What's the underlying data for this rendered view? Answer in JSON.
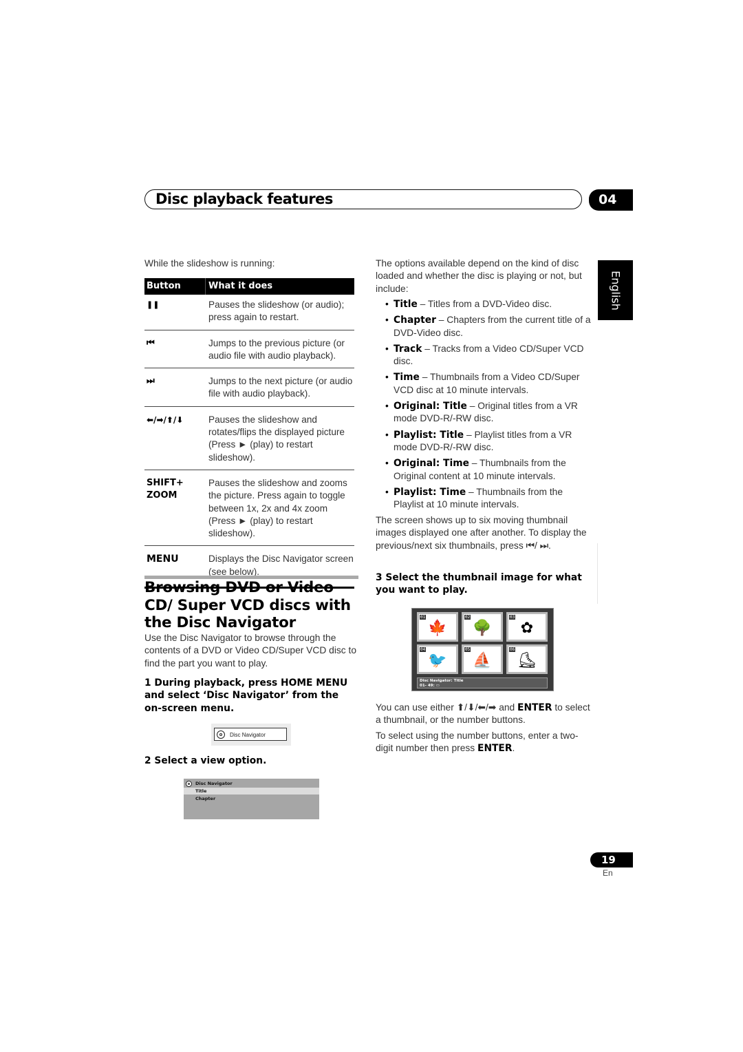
{
  "header": {
    "title": "Disc playback features",
    "chapter": "04"
  },
  "language_tab": "English",
  "left_column": {
    "intro": "While the slideshow is running:",
    "table": {
      "headers": [
        "Button",
        "What it does"
      ],
      "rows": [
        {
          "button": "❚❚",
          "button_icon": "pause-icon",
          "desc": "Pauses the slideshow (or audio); press again to restart."
        },
        {
          "button": "⏮",
          "button_icon": "previous-icon",
          "desc": "Jumps to the previous picture (or audio file with audio playback)."
        },
        {
          "button": "⏭",
          "button_icon": "next-icon",
          "desc": "Jumps to the next picture (or audio file with audio playback)."
        },
        {
          "button": "⬅/➡/⬆/⬇",
          "button_icon": "arrow-keys-icon",
          "desc": "Pauses the slideshow and rotates/flips the displayed picture (Press ► (play) to restart slideshow)."
        },
        {
          "button": "SHIFT+ ZOOM",
          "button_icon": "",
          "desc": "Pauses the slideshow and zooms the picture. Press again to toggle between 1x, 2x and 4x zoom (Press ► (play) to restart slideshow)."
        },
        {
          "button": "MENU",
          "button_icon": "",
          "desc": "Displays the Disc Navigator screen (see below)."
        }
      ]
    },
    "section_title": "Browsing DVD or Video CD/ Super VCD discs with the Disc Navigator",
    "section_intro": "Use the Disc Navigator to browse through the contents of a DVD or Video CD/Super VCD disc to find the part you want to play.",
    "step1": "1   During playback, press HOME MENU and select ‘Disc Navigator’ from the on-screen menu.",
    "disc_nav_item": "Disc Navigator",
    "step2": "2   Select a view option.",
    "disc_nav_menu": {
      "title": "Disc Navigator",
      "options": [
        "Title",
        "Chapter"
      ],
      "selected": "Title"
    }
  },
  "right_column": {
    "intro": "The options available depend on the kind of disc loaded and whether the disc is playing or not, but include:",
    "options": [
      {
        "term": "Title",
        "desc": " – Titles from a DVD-Video disc."
      },
      {
        "term": "Chapter",
        "desc": " – Chapters from the current title of a DVD-Video disc."
      },
      {
        "term": "Track",
        "desc": " – Tracks from a Video CD/Super VCD disc."
      },
      {
        "term": "Time",
        "desc": " – Thumbnails from a Video CD/Super VCD disc at 10 minute intervals."
      },
      {
        "term": "Original: Title",
        "desc": " – Original titles from a VR mode DVD-R/-RW disc."
      },
      {
        "term": "Playlist: Title",
        "desc": " – Playlist titles from a VR mode DVD-R/-RW disc."
      },
      {
        "term": "Original: Time",
        "desc": " – Thumbnails from the Original content at 10 minute intervals."
      },
      {
        "term": "Playlist: Time",
        "desc": " – Thumbnails from the Playlist at 10 minute intervals."
      }
    ],
    "screen_note": "The screen shows up to six moving thumbnail images displayed one after another. To display the previous/next six thumbnails, press ⏮/ ⏭.",
    "step3": "3   Select the thumbnail image for what you want to play.",
    "thumbnails": [
      {
        "num": "01",
        "icon": "leaf-icon",
        "glyph": "🍁"
      },
      {
        "num": "02",
        "icon": "tree-icon",
        "glyph": "🌳"
      },
      {
        "num": "03",
        "icon": "flower-icon",
        "glyph": "✿"
      },
      {
        "num": "04",
        "icon": "toucan-icon",
        "glyph": "🐦"
      },
      {
        "num": "05",
        "icon": "windsurfer-icon",
        "glyph": "⛵"
      },
      {
        "num": "06",
        "icon": "skater-icon",
        "glyph": "⛸"
      }
    ],
    "thumb_status_line1": "Disc Navigator: Title",
    "thumb_status_line2": "01- 49: ▭",
    "select_note_pre": "You can use either ⬆/⬇/⬅/➡ and ",
    "select_note_enter": "ENTER",
    "select_note_post": " to select a thumbnail, or the number buttons.",
    "number_note_pre": "To select using the number buttons, enter a two-digit number then press ",
    "number_note_enter": "ENTER",
    "number_note_post": "."
  },
  "footer": {
    "page": "19",
    "lang": "En"
  }
}
